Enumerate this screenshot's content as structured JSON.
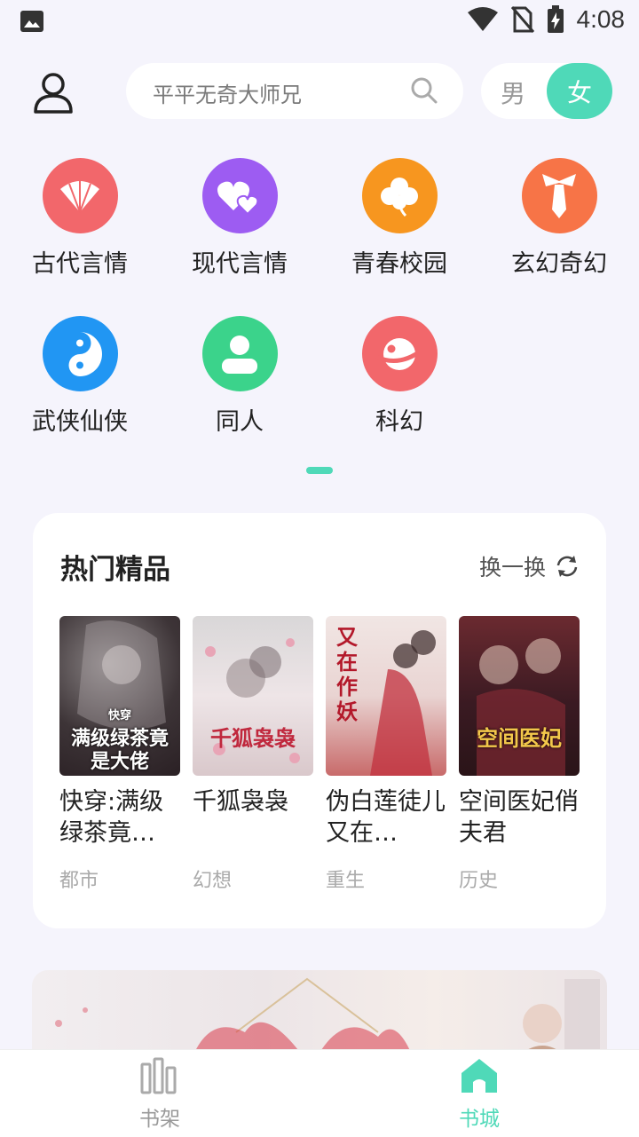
{
  "status_bar": {
    "time": "4:08"
  },
  "header": {
    "search_placeholder": "平平无奇大师兄",
    "gender_male": "男",
    "gender_female": "女",
    "gender_selected": "女"
  },
  "categories": [
    {
      "label": "古代言情",
      "icon": "fan-icon",
      "color": "#f2676b"
    },
    {
      "label": "现代言情",
      "icon": "hearts-icon",
      "color": "#9d5cf2"
    },
    {
      "label": "青春校园",
      "icon": "clover-icon",
      "color": "#f7961f"
    },
    {
      "label": "玄幻奇幻",
      "icon": "tie-icon",
      "color": "#f77447"
    },
    {
      "label": "武侠仙侠",
      "icon": "yin-yang-icon",
      "color": "#2196f3"
    },
    {
      "label": "同人",
      "icon": "person-icon",
      "color": "#3bd38b"
    },
    {
      "label": "科幻",
      "icon": "planet-icon",
      "color": "#f2676b"
    }
  ],
  "hot": {
    "title": "热门精品",
    "refresh_label": "换一换",
    "books": [
      {
        "name": "快穿:满级绿茶竟…",
        "genre": "都市",
        "cover_title": "满级绿茶竟是大佬",
        "cover_tag": "快穿"
      },
      {
        "name": "千狐袅袅",
        "genre": "幻想",
        "cover_title": "千狐袅袅"
      },
      {
        "name": "伪白莲徒儿又在…",
        "genre": "重生",
        "cover_title": "又在作妖"
      },
      {
        "name": "空间医妃俏夫君",
        "genre": "历史",
        "cover_title": "空间医妃"
      }
    ]
  },
  "bottom_nav": [
    {
      "label": "书架",
      "icon": "bookshelf-icon",
      "active": false
    },
    {
      "label": "书城",
      "icon": "home-icon",
      "active": true
    }
  ],
  "colors": {
    "accent": "#4fd9b8",
    "background": "#f5f4fc"
  }
}
